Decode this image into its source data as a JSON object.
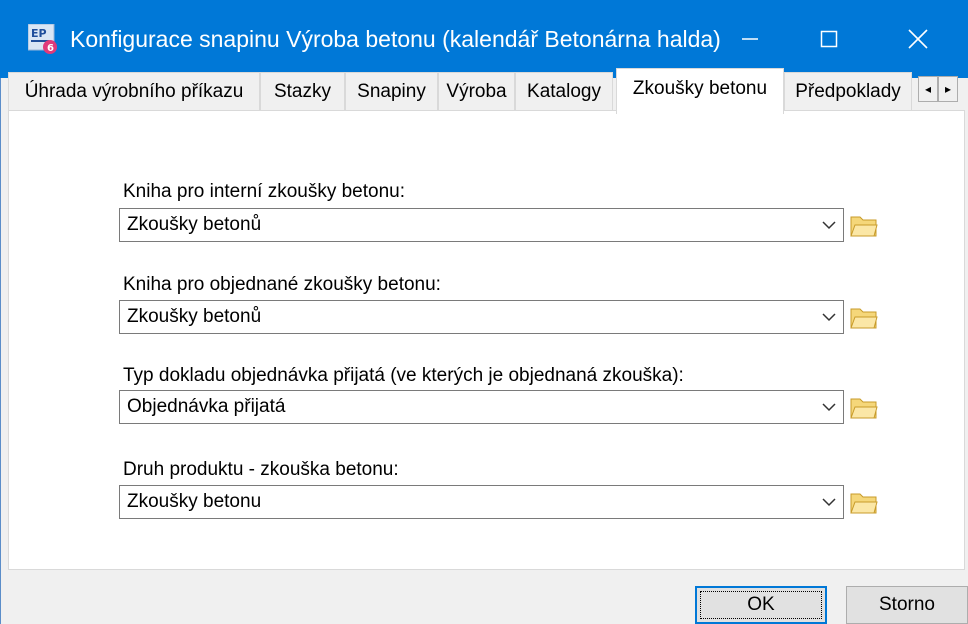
{
  "window": {
    "title": "Konfigurace snapinu Výroba betonu (kalendář Betonárna halda)",
    "app_icon": "ep-app-icon",
    "controls": {
      "minimize": "minimize-icon",
      "maximize": "maximize-icon",
      "close": "close-icon"
    },
    "title_bar_color": "#0078d7"
  },
  "tabs": [
    {
      "label": "Úhrada výrobního příkazu",
      "active": false
    },
    {
      "label": "Stazky",
      "active": false
    },
    {
      "label": "Snapiny",
      "active": false
    },
    {
      "label": "Výroba",
      "active": false
    },
    {
      "label": "Katalogy",
      "active": false
    },
    {
      "label": "Zkoušky betonu",
      "active": true
    },
    {
      "label": "Předpoklady",
      "active": false
    }
  ],
  "tab_scroll": {
    "left": "◂",
    "right": "▸"
  },
  "fields": [
    {
      "label": "Kniha pro interní zkoušky betonu:",
      "value": "Zkoušky betonů"
    },
    {
      "label": "Kniha pro objednané zkoušky betonu:",
      "value": "Zkoušky betonů"
    },
    {
      "label": "Typ dokladu objednávka přijatá (ve kterých je objednaná zkouška):",
      "value": "Objednávka přijatá"
    },
    {
      "label": "Druh produktu - zkouška betonu:",
      "value": "Zkoušky betonu"
    }
  ],
  "buttons": {
    "ok": "OK",
    "cancel": "Storno"
  }
}
